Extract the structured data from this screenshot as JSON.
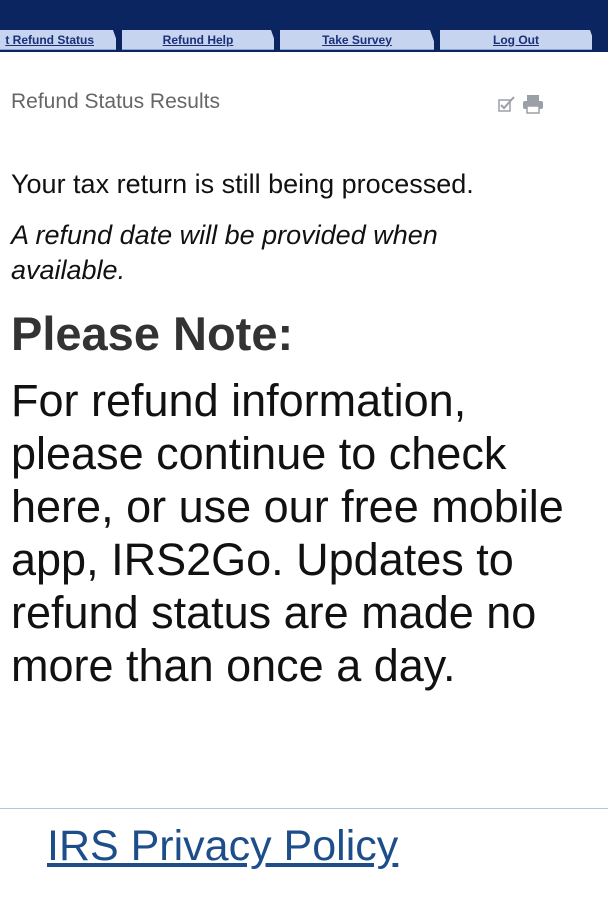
{
  "nav": {
    "tabs": [
      {
        "label": "t Refund Status"
      },
      {
        "label": "Refund Help"
      },
      {
        "label": "Take Survey"
      },
      {
        "label": "Log Out"
      }
    ]
  },
  "results": {
    "title": "Refund Status Results",
    "status_message": "Your tax return is still being processed.",
    "refund_date_note": "A refund date will be provided when available."
  },
  "note": {
    "heading": "Please Note:",
    "body": "For refund information, please continue to check here, or use our free mobile app, IRS2Go. Updates to refund status are made no more than once a day."
  },
  "footer": {
    "privacy_link": "IRS Privacy Policy"
  },
  "icons": {
    "edit": "checkmark-edit-icon",
    "print": "printer-icon"
  },
  "colors": {
    "header_navy": "#0b2561",
    "tab_fill": "#c6d4ef",
    "link_blue": "#1d4e89"
  }
}
